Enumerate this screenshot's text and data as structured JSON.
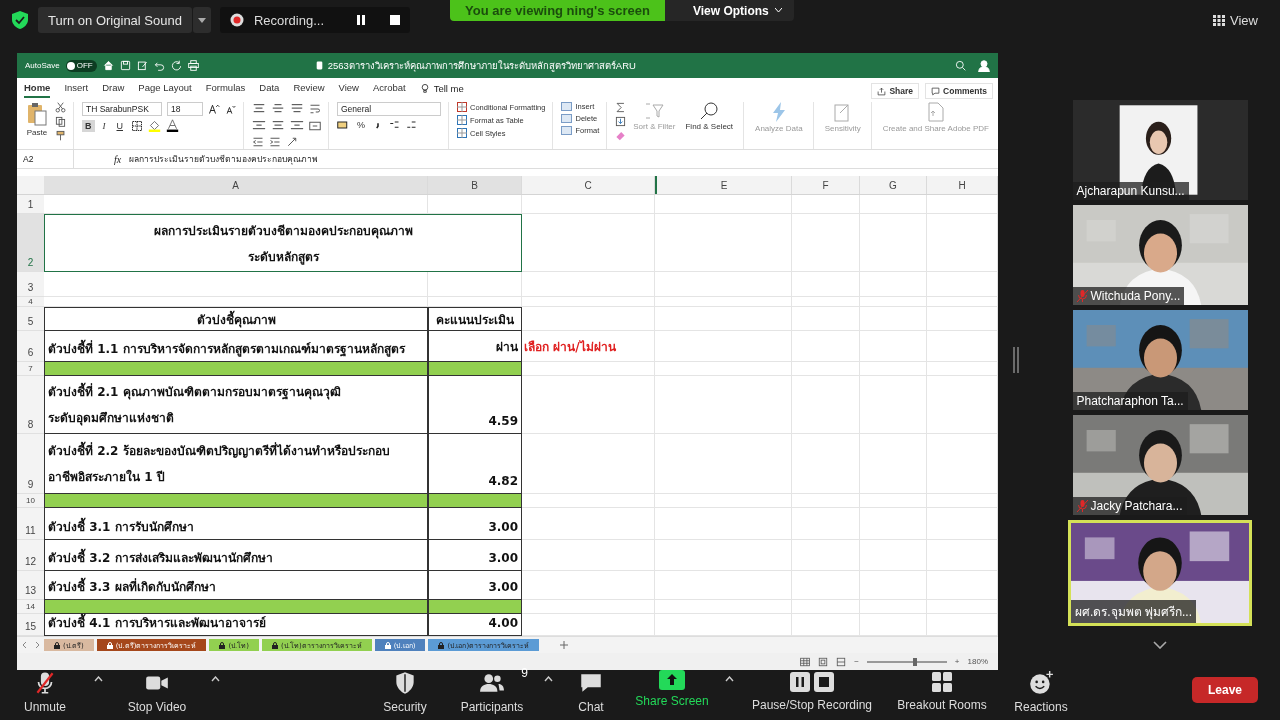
{
  "meeting_bar": {
    "original_sound": "Turn on Original Sound",
    "recording": "Recording...",
    "banner": "You are viewing ning's screen",
    "view_options": "View Options",
    "view": "View"
  },
  "excel": {
    "autosave": {
      "label": "AutoSave",
      "state": "OFF",
      "on": false
    },
    "title": "2563ตารางวิเคราะห์คุณภาพการศึกษาภายในระดับหลักสูตรวิทยาศาสตร์ARU",
    "tabs": [
      {
        "label": "Home",
        "selected": true
      },
      {
        "label": "Insert",
        "selected": false
      },
      {
        "label": "Draw",
        "selected": false
      },
      {
        "label": "Page Layout",
        "selected": false
      },
      {
        "label": "Formulas",
        "selected": false
      },
      {
        "label": "Data",
        "selected": false
      },
      {
        "label": "Review",
        "selected": false
      },
      {
        "label": "View",
        "selected": false
      },
      {
        "label": "Acrobat",
        "selected": false
      }
    ],
    "tell_me": "Tell me",
    "share": "Share",
    "comments": "Comments",
    "ribbon": {
      "paste": "Paste",
      "font": "TH SarabunPSK",
      "size": "18",
      "bold": {
        "label": "B",
        "on": true
      },
      "italic": "I",
      "underline": "U",
      "number_format": "General",
      "percent": "%",
      "styles": [
        "Conditional Formatting",
        "Format as Table",
        "Cell Styles"
      ],
      "cells": [
        "Insert",
        "Delete",
        "Format"
      ],
      "sort": "Sort & Filter",
      "find": "Find & Select",
      "analyze": "Analyze Data",
      "sensitivity": "Sensitivity",
      "pdf": "Create and Share Adobe PDF"
    },
    "name_box": "A2",
    "fx": "fx",
    "formula": "ผลการประเมินรายตัวบงชีตามองคประกอบคุณภาพ",
    "columns": [
      {
        "label": "A",
        "selected": true
      },
      {
        "label": "B",
        "selected": true
      },
      {
        "label": "C",
        "selected": false
      },
      {
        "label": "E",
        "selected": false
      },
      {
        "label": "F",
        "selected": false
      },
      {
        "label": "G",
        "selected": false
      },
      {
        "label": "H",
        "selected": false
      }
    ],
    "rows": [
      {
        "number": "1",
        "kind": "blank"
      },
      {
        "number": "2",
        "kind": "title",
        "selected": true,
        "lines": [
          "ผลการประเมินรายตัวบงชีตามองคประกอบคุณภาพ",
          "ระดับหลักสูตร"
        ]
      },
      {
        "number": "3",
        "kind": "blank"
      },
      {
        "number": "4",
        "kind": "blank"
      },
      {
        "number": "5",
        "kind": "header",
        "a": "ตัวบ่งชี้คุณภาพ",
        "b": "คะแนนประเมิน"
      },
      {
        "number": "6",
        "kind": "item",
        "lines": [
          "ตัวบ่งชี้ที่ 1.1 การบริหารจัดการหลักสูตรตามเกณฑ์มาตรฐานหลักสูตร"
        ],
        "b": "ผ่าน",
        "note": "เลือก ผ่าน/ไม่ผ่าน"
      },
      {
        "number": "7",
        "kind": "band"
      },
      {
        "number": "8",
        "kind": "item",
        "lines": [
          "ตัวบ่งชี้ที่ 2.1 คุณภาพบัณฑิตตามกรอบมาตรฐานคุณวุฒิ",
          "ระดับอุดมศึกษาแห่งชาติ"
        ],
        "b": "4.59"
      },
      {
        "number": "9",
        "kind": "item",
        "lines": [
          "ตัวบ่งชี้ที่ 2.2 ร้อยละของบัณฑิตปริญญาตรีที่ได้งานทำหรือประกอบ",
          "อาชีพอิสระภายใน 1 ปี"
        ],
        "b": "4.82"
      },
      {
        "number": "10",
        "kind": "band"
      },
      {
        "number": "11",
        "kind": "item",
        "lines": [
          "ตัวบ่งชี้ 3.1 การรับนักศึกษา"
        ],
        "b": "3.00"
      },
      {
        "number": "12",
        "kind": "item",
        "lines": [
          "ตัวบ่งชี้ 3.2 การส่งเสริมและพัฒนานักศึกษา"
        ],
        "b": "3.00"
      },
      {
        "number": "13",
        "kind": "item",
        "lines": [
          "ตัวบ่งชี้ 3.3 ผลที่เกิดกับนักศึกษา"
        ],
        "b": "3.00"
      },
      {
        "number": "14",
        "kind": "band"
      },
      {
        "number": "15",
        "kind": "item",
        "lines": [
          "ตัวบ่งชี้ 4.1 การบริหารและพัฒนาอาจารย์"
        ],
        "b": "4.00"
      }
    ],
    "sheet_tabs": [
      {
        "label": "(ป.ตรี)",
        "color": "#d9b9a0"
      },
      {
        "label": "(ป.ตรี)ตารางการวิเคราะห์",
        "color": "#a5471b"
      },
      {
        "label": "(ป.โท)",
        "color": "#92d050"
      },
      {
        "label": "(ป.โท)ตารางการวิเคราะห์",
        "color": "#92d050"
      },
      {
        "label": "(ป.เอก)",
        "color": "#4f81bd"
      },
      {
        "label": "(ป.เอก)ตารางการวิเคราะห์",
        "color": "#5b9bd5"
      }
    ],
    "zoom_out": "−",
    "zoom_slider": {
      "level": 0.6
    },
    "zoom_in": "+",
    "zoom": "180%"
  },
  "videos": [
    {
      "name": "Ajcharapun Kunsu...",
      "muted": false,
      "speaking": false
    },
    {
      "name": "Witchuda Pony...",
      "muted": true,
      "speaking": false
    },
    {
      "name": "Phatcharaphon Ta...",
      "muted": false,
      "speaking": false
    },
    {
      "name": "Jacky Patchara...",
      "muted": true,
      "speaking": false
    },
    {
      "name": "ผศ.ดร.จุมพต พุ่มศรีก...",
      "muted": false,
      "speaking": true
    }
  ],
  "toolbar": {
    "items": [
      {
        "kind": "mic",
        "label": "Unmute",
        "muted": true,
        "caret": true
      },
      {
        "kind": "video",
        "label": "Stop Video",
        "caret": true
      },
      {
        "kind": "security",
        "label": "Security",
        "caret": false
      },
      {
        "kind": "participants",
        "label": "Participants",
        "count": "9",
        "caret": true
      },
      {
        "kind": "chat",
        "label": "Chat",
        "caret": false
      },
      {
        "kind": "share",
        "label": "Share Screen",
        "caret": true
      },
      {
        "kind": "recording",
        "label": "Pause/Stop Recording",
        "caret": false
      },
      {
        "kind": "breakout",
        "label": "Breakout Rooms",
        "caret": false
      },
      {
        "kind": "reactions",
        "label": "Reactions",
        "caret": false
      }
    ],
    "leave": "Leave"
  }
}
